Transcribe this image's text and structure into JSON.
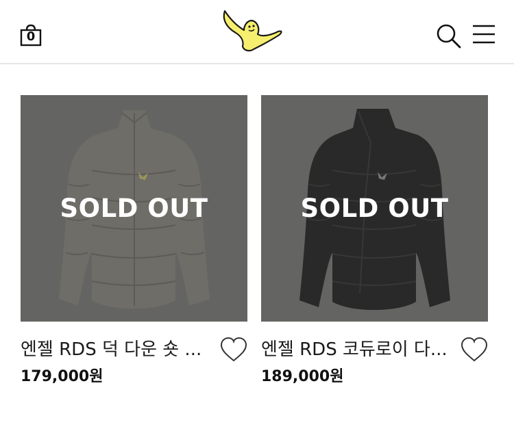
{
  "header": {
    "cart_count": "0",
    "logo_icon": "angel-bird-logo",
    "search_icon": "search-icon",
    "menu_icon": "hamburger-menu-icon"
  },
  "products": [
    {
      "name": "엔젤 RDS 덕 다운 숏 ...",
      "price": "179,000원",
      "badge": "SOLD OUT",
      "jacket_color": "#8c8a80"
    },
    {
      "name": "엔젤 RDS 코듀로이 다...",
      "price": "189,000원",
      "badge": "SOLD OUT",
      "jacket_color": "#161616"
    }
  ],
  "colors": {
    "logo_yellow": "#f6ee6e",
    "overlay": "#6b6b6b",
    "text": "#1a1a1a"
  }
}
